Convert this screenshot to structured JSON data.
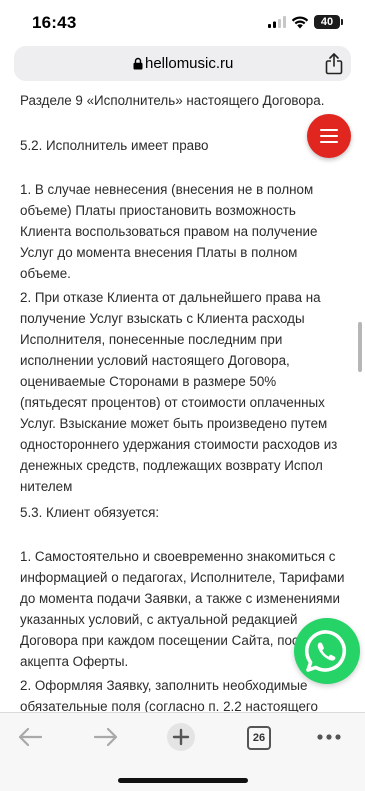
{
  "status": {
    "time": "16:43",
    "battery": "40"
  },
  "browser": {
    "url": "hellomusic.ru",
    "tabs_count": "26"
  },
  "content": {
    "line0": "Разделе 9 «Исполнитель» настоящего Договора.",
    "clause_5_2_heading": "5.2. Исполнитель имеет право",
    "clause_5_2_1": "1. В случае невнесения (внесения не в полном объеме) Платы приостановить возможность Клиента воспользоваться правом на получение Услуг до момента внесения Платы в полном объеме.",
    "clause_5_2_2": "2. При отказе Клиента от дальнейшего права на получение Услуг взыскать с Клиента расходы Исполнителя, понесенные последним при исполнении условий настоящего Договора, оцениваемые Сторонами в размере 50% (пятьдесят процентов) от стоимости оплаченных Услуг. Взыскание может быть произведено путем одностороннего удержания стоимости расходов из денежных средств, подлежащих возврату Испол нителем",
    "clause_5_3_heading": "5.3. Клиент обязуется:",
    "clause_5_3_1": "1. Самостоятельно и своевременно знакомиться с информацией о педагогах, Исполнителе, Тарифами до момента подачи Заявки, а также с изменениями указанных условий, с актуальной редакцией Договора при каждом посещении Сайта, после акцепта Оферты.",
    "clause_5_3_2": "2. Оформляя Заявку, заполнить необходимые обязательные поля (согласно п. 2.2 настоящего"
  },
  "colors": {
    "menu_fab": "#e0261f",
    "whatsapp": "#25d366"
  }
}
